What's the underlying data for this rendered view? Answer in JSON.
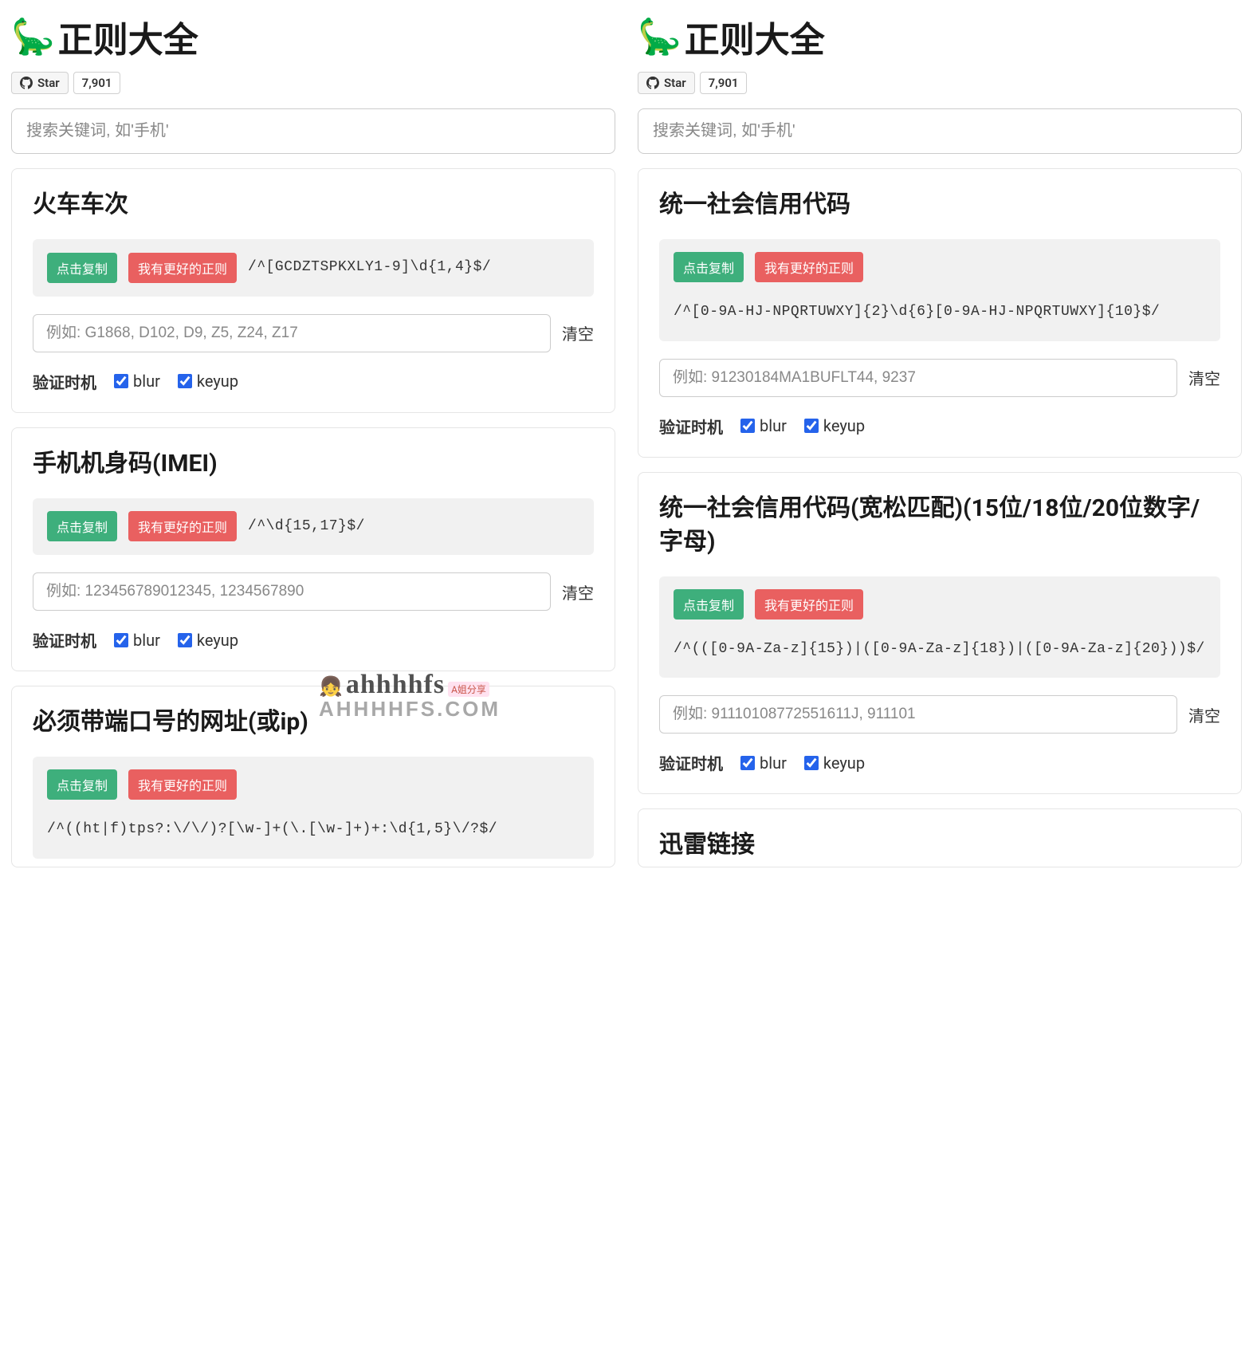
{
  "title_icon": "🦕",
  "title_text": "正则大全",
  "github": {
    "star_label": "Star",
    "count": "7,901"
  },
  "search_placeholder": "搜索关键词, 如'手机'",
  "btn_copy": "点击复制",
  "btn_better": "我有更好的正则",
  "btn_clear": "清空",
  "verify_label": "验证时机",
  "check_blur": "blur",
  "check_keyup": "keyup",
  "left_cards": [
    {
      "title": "火车车次",
      "regex": "/^[GCDZTSPKXLY1-9]\\d{1,4}$/",
      "placeholder": "例如: G1868, D102, D9, Z5, Z24, Z17"
    },
    {
      "title": "手机机身码(IMEI)",
      "regex": "/^\\d{15,17}$/",
      "placeholder": "例如: 123456789012345, 1234567890"
    },
    {
      "title": "必须带端口号的网址(或ip)",
      "regex": "/^((ht|f)tps?:\\/\\/)?[\\w-]+(\\.[\\w-]+)+:\\d{1,5}\\/?$/",
      "placeholder": ""
    }
  ],
  "right_cards": [
    {
      "title": "统一社会信用代码",
      "regex": "/^[0-9A-HJ-NPQRTUWXY]{2}\\d{6}[0-9A-HJ-NPQRTUWXY]{10}$/",
      "placeholder": "例如: 91230184MA1BUFLT44, 9237"
    },
    {
      "title": "统一社会信用代码(宽松匹配)(15位/18位/20位数字/字母)",
      "regex": "/^(([0-9A-Za-z]{15})|([0-9A-Za-z]{18})|([0-9A-Za-z]{20}))$/",
      "placeholder": "例如: 91110108772551611J, 911101"
    },
    {
      "title": "迅雷链接",
      "regex": "",
      "placeholder": ""
    }
  ],
  "watermark": {
    "line1": "ahhhhfs",
    "badge": "A姐分享",
    "line2": "AHHHHFS.COM"
  }
}
